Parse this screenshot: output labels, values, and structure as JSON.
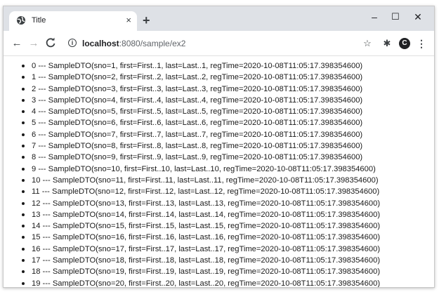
{
  "browser": {
    "tab": {
      "title": "Title",
      "close": "×"
    },
    "new_tab": "+",
    "window_controls": {
      "minimize": "–",
      "maximize": "☐",
      "close": "✕"
    },
    "nav": {
      "back": "←",
      "forward": "→",
      "reload": "C"
    },
    "address": {
      "host": "localhost",
      "path": ":8080/sample/ex2",
      "info": "i"
    },
    "icons": {
      "star": "☆",
      "extensions": "✱",
      "profile": "C",
      "menu": "⋮"
    }
  },
  "items": [
    "0 --- SampleDTO(sno=1, first=First..1, last=Last..1, regTime=2020-10-08T11:05:17.398354600)",
    "1 --- SampleDTO(sno=2, first=First..2, last=Last..2, regTime=2020-10-08T11:05:17.398354600)",
    "2 --- SampleDTO(sno=3, first=First..3, last=Last..3, regTime=2020-10-08T11:05:17.398354600)",
    "3 --- SampleDTO(sno=4, first=First..4, last=Last..4, regTime=2020-10-08T11:05:17.398354600)",
    "4 --- SampleDTO(sno=5, first=First..5, last=Last..5, regTime=2020-10-08T11:05:17.398354600)",
    "5 --- SampleDTO(sno=6, first=First..6, last=Last..6, regTime=2020-10-08T11:05:17.398354600)",
    "6 --- SampleDTO(sno=7, first=First..7, last=Last..7, regTime=2020-10-08T11:05:17.398354600)",
    "7 --- SampleDTO(sno=8, first=First..8, last=Last..8, regTime=2020-10-08T11:05:17.398354600)",
    "8 --- SampleDTO(sno=9, first=First..9, last=Last..9, regTime=2020-10-08T11:05:17.398354600)",
    "9 --- SampleDTO(sno=10, first=First..10, last=Last..10, regTime=2020-10-08T11:05:17.398354600)",
    "10 --- SampleDTO(sno=11, first=First..11, last=Last..11, regTime=2020-10-08T11:05:17.398354600)",
    "11 --- SampleDTO(sno=12, first=First..12, last=Last..12, regTime=2020-10-08T11:05:17.398354600)",
    "12 --- SampleDTO(sno=13, first=First..13, last=Last..13, regTime=2020-10-08T11:05:17.398354600)",
    "13 --- SampleDTO(sno=14, first=First..14, last=Last..14, regTime=2020-10-08T11:05:17.398354600)",
    "14 --- SampleDTO(sno=15, first=First..15, last=Last..15, regTime=2020-10-08T11:05:17.398354600)",
    "15 --- SampleDTO(sno=16, first=First..16, last=Last..16, regTime=2020-10-08T11:05:17.398354600)",
    "16 --- SampleDTO(sno=17, first=First..17, last=Last..17, regTime=2020-10-08T11:05:17.398354600)",
    "17 --- SampleDTO(sno=18, first=First..18, last=Last..18, regTime=2020-10-08T11:05:17.398354600)",
    "18 --- SampleDTO(sno=19, first=First..19, last=Last..19, regTime=2020-10-08T11:05:17.398354600)",
    "19 --- SampleDTO(sno=20, first=First..20, last=Last..20, regTime=2020-10-08T11:05:17.398354600)"
  ]
}
